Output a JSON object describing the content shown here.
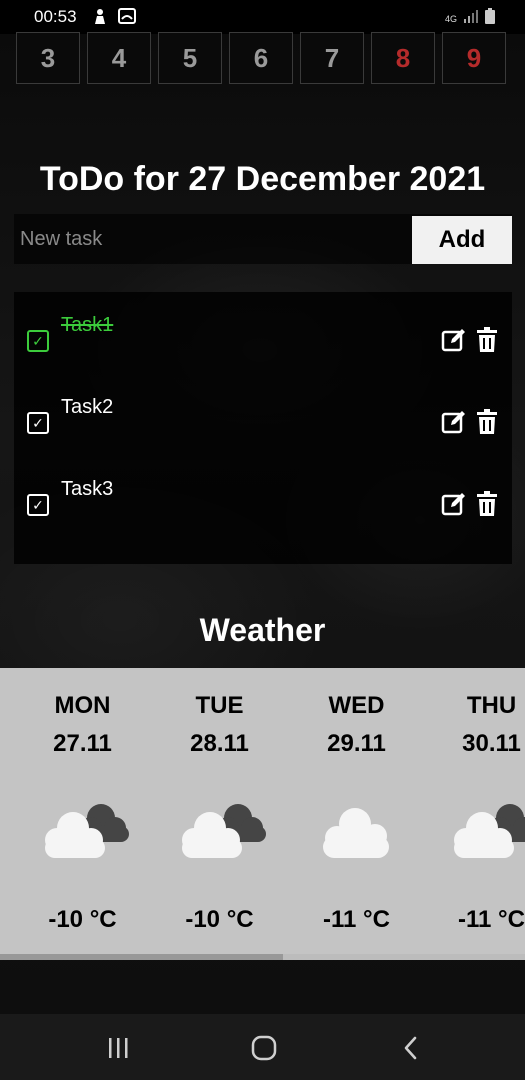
{
  "status_bar": {
    "time": "00:53",
    "network_label": "4G"
  },
  "calendar": {
    "days": [
      "3",
      "4",
      "5",
      "6",
      "7",
      "8",
      "9"
    ],
    "weekend_color": "#b52b2b"
  },
  "todo": {
    "title": "ToDo for 27 December 2021",
    "input_placeholder": "New task",
    "add_label": "Add",
    "tasks": [
      {
        "label": "Task1",
        "done": true
      },
      {
        "label": "Task2",
        "done": false
      },
      {
        "label": "Task3",
        "done": false
      }
    ],
    "done_color": "#3ccc3c"
  },
  "weather": {
    "title": "Weather",
    "days": [
      {
        "day": "MON",
        "date": "27.11",
        "temp": "-10 °C",
        "icon": "partly-cloudy-icon"
      },
      {
        "day": "TUE",
        "date": "28.11",
        "temp": "-10 °C",
        "icon": "partly-cloudy-icon"
      },
      {
        "day": "WED",
        "date": "29.11",
        "temp": "-11 °C",
        "icon": "cloud-icon"
      },
      {
        "day": "THU",
        "date": "30.11",
        "temp": "-11 °C",
        "icon": "partly-cloudy-icon"
      }
    ]
  },
  "navigation": {
    "recents_icon": "recents-icon",
    "home_icon": "home-icon",
    "back_icon": "back-icon"
  }
}
